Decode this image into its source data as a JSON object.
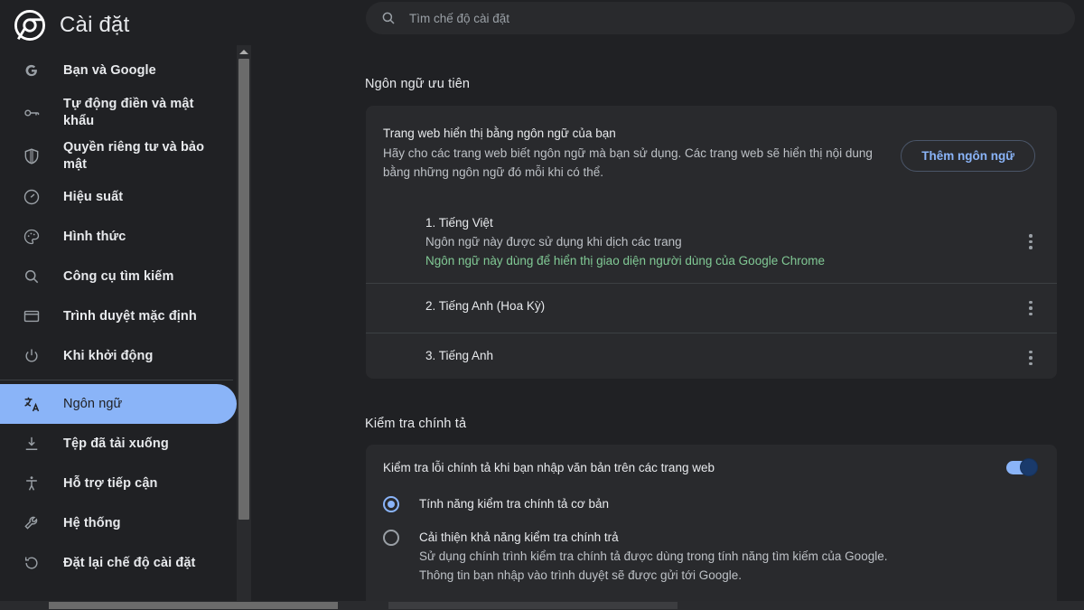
{
  "app": {
    "title": "Cài đặt",
    "logo_icon": "chrome-logo-icon"
  },
  "search": {
    "placeholder": "Tìm chế độ cài đặt",
    "value": "",
    "icon": "search-icon"
  },
  "sidebar": {
    "items": [
      {
        "label": "Bạn và Google",
        "icon": "google-g-icon",
        "selected": false
      },
      {
        "label": "Tự động điền và mật khẩu",
        "icon": "key-icon",
        "selected": false
      },
      {
        "label": "Quyền riêng tư và bảo mật",
        "icon": "shield-icon",
        "selected": false
      },
      {
        "label": "Hiệu suất",
        "icon": "speedometer-icon",
        "selected": false
      },
      {
        "label": "Hình thức",
        "icon": "palette-icon",
        "selected": false
      },
      {
        "label": "Công cụ tìm kiếm",
        "icon": "search-icon",
        "selected": false
      },
      {
        "label": "Trình duyệt mặc định",
        "icon": "browser-window-icon",
        "selected": false
      },
      {
        "label": "Khi khởi động",
        "icon": "power-icon",
        "selected": false
      },
      {
        "label": "Ngôn ngữ",
        "icon": "translate-icon",
        "selected": true
      },
      {
        "label": "Tệp đã tải xuống",
        "icon": "download-icon",
        "selected": false
      },
      {
        "label": "Hỗ trợ tiếp cận",
        "icon": "accessibility-icon",
        "selected": false
      },
      {
        "label": "Hệ thống",
        "icon": "wrench-icon",
        "selected": false
      },
      {
        "label": "Đặt lại chế độ cài đặt",
        "icon": "restore-icon",
        "selected": false
      }
    ]
  },
  "main": {
    "languages_section": {
      "heading": "Ngôn ngữ ưu tiên",
      "card_title": "Trang web hiển thị bằng ngôn ngữ của bạn",
      "card_desc": "Hãy cho các trang web biết ngôn ngữ mà bạn sử dụng. Các trang web sẽ hiển thị nội dung bằng những ngôn ngữ đó mỗi khi có thể.",
      "add_button": "Thêm ngôn ngữ",
      "list": [
        {
          "name": "1. Tiếng Việt",
          "sub1": "Ngôn ngữ này được sử dụng khi dịch các trang",
          "sub2": "Ngôn ngữ này dùng để hiển thị giao diện người dùng của Google Chrome",
          "menu_icon": "more-vert-icon"
        },
        {
          "name": "2. Tiếng Anh (Hoa Kỳ)",
          "sub1": "",
          "sub2": "",
          "menu_icon": "more-vert-icon"
        },
        {
          "name": "3. Tiếng Anh",
          "sub1": "",
          "sub2": "",
          "menu_icon": "more-vert-icon"
        }
      ]
    },
    "spellcheck_section": {
      "heading": "Kiểm tra chính tả",
      "toggle_label": "Kiểm tra lỗi chính tả khi bạn nhập văn bản trên các trang web",
      "toggle_state": "on",
      "options": [
        {
          "label": "Tính năng kiểm tra chính tả cơ bản",
          "desc": "",
          "selected": true
        },
        {
          "label": "Cải thiện khả năng kiểm tra chính trả",
          "desc": "Sử dụng chính trình kiểm tra chính tả được dùng trong tính năng tìm kiếm của Google. Thông tin bạn nhập vào trình duyệt sẽ được gửi tới Google.",
          "selected": false
        }
      ]
    }
  },
  "colors": {
    "background": "#202124",
    "card": "#292a2d",
    "accent": "#8ab4f8",
    "green": "#81c995",
    "text": "#e8eaed",
    "muted": "#bdc1c6",
    "divider": "#3c4043"
  }
}
